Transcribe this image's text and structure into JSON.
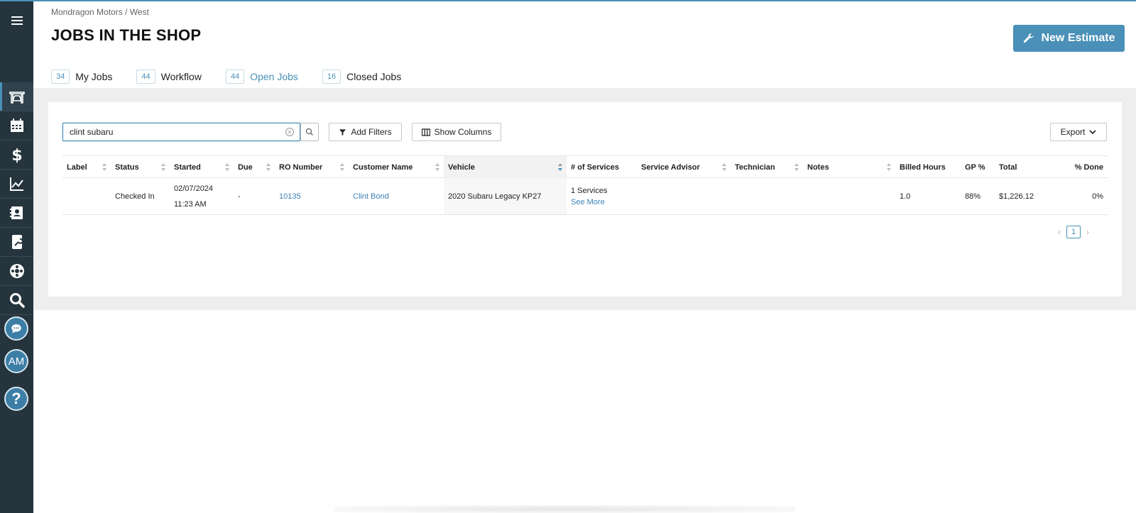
{
  "breadcrumb": "Mondragon Motors / West",
  "page_title": "JOBS IN THE SHOP",
  "new_estimate_label": "New Estimate",
  "tabs": [
    {
      "count": "34",
      "label": "My Jobs"
    },
    {
      "count": "44",
      "label": "Workflow"
    },
    {
      "count": "44",
      "label": "Open Jobs",
      "active": true
    },
    {
      "count": "16",
      "label": "Closed Jobs"
    }
  ],
  "search": {
    "value": "clint subaru"
  },
  "toolbar": {
    "add_filters_label": "Add Filters",
    "show_columns_label": "Show Columns",
    "export_label": "Export"
  },
  "columns": [
    "Label",
    "Status",
    "Started",
    "Due",
    "RO Number",
    "Customer Name",
    "Vehicle",
    "# of Services",
    "Service Advisor",
    "Technician",
    "Notes",
    "Billed Hours",
    "GP %",
    "Total",
    "% Done"
  ],
  "rows": [
    {
      "label": "",
      "status": "Checked In",
      "started_date": "02/07/2024",
      "started_time": "11:23 AM",
      "due": "-",
      "ro_number": "10135",
      "customer_name": "Clint Bond",
      "vehicle": "2020 Subaru Legacy KP27",
      "services": "1 Services",
      "see_more": "See More",
      "service_advisor": "",
      "technician": "",
      "notes": "",
      "billed_hours": "1.0",
      "gp_percent": "88%",
      "total": "$1,226.12",
      "percent_done": "0%"
    }
  ],
  "pagination": {
    "current_page": "1"
  },
  "sidebar": {
    "user_initials": "AM",
    "help_label": "?"
  },
  "colors": {
    "accent": "#4a90b8",
    "sidebar_bg": "#25343d",
    "link": "#3b82b8"
  },
  "icons": [
    "menu-icon",
    "shop-lift-icon",
    "calendar-icon",
    "dollar-icon",
    "chart-icon",
    "contacts-icon",
    "parts-icon",
    "tire-icon",
    "search-icon",
    "chat-icon",
    "help-icon",
    "wrench-icon",
    "filter-icon",
    "columns-icon",
    "chevron-down-icon",
    "clear-icon"
  ]
}
